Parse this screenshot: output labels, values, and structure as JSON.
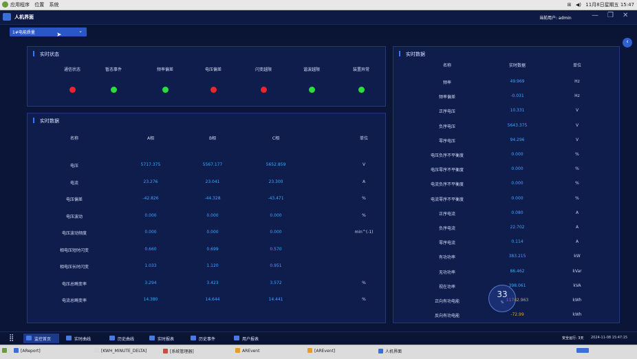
{
  "os_bar": {
    "menus": [
      "应用程序",
      "位置",
      "系统"
    ],
    "datetime": "11月8日星期五 15:47"
  },
  "window": {
    "title": "人机界面",
    "current_user": "当前用户: admin",
    "controls": {
      "minimize": "—",
      "maximize": "❐",
      "close": "✕"
    }
  },
  "device_select": {
    "value": "1#电能质量",
    "collapse": "‹"
  },
  "status_panel": {
    "title": "实时状态",
    "items": [
      {
        "label": "通信状态",
        "color": "#e8262b"
      },
      {
        "label": "暂态事件",
        "color": "#2bdc3a"
      },
      {
        "label": "频率偏差",
        "color": "#2bdc3a"
      },
      {
        "label": "电压偏差",
        "color": "#e8262b"
      },
      {
        "label": "闪变越限",
        "color": "#e8262b"
      },
      {
        "label": "谐波越限",
        "color": "#2bdc3a"
      },
      {
        "label": "装置异常",
        "color": "#2bdc3a"
      }
    ]
  },
  "phase_panel": {
    "title": "实时数据",
    "headers": [
      "名称",
      "A相",
      "B相",
      "C相",
      "单位"
    ],
    "rows": [
      [
        "电压",
        "5717.375",
        "5567.177",
        "5652.859",
        "V"
      ],
      [
        "电流",
        "23.276",
        "23.041",
        "23.300",
        "A"
      ],
      [
        "电压偏差",
        "-42.826",
        "-44.328",
        "-43.471",
        "%"
      ],
      [
        "电压波动",
        "0.000",
        "0.000",
        "0.000",
        "%"
      ],
      [
        "电压波动频度",
        "0.000",
        "0.000",
        "0.000",
        "min^(-1)"
      ],
      [
        "相电压短时闪变",
        "0.660",
        "0.699",
        "0.570",
        ""
      ],
      [
        "相电压长时闪变",
        "1.033",
        "1.120",
        "0.951",
        ""
      ],
      [
        "电压总畸变率",
        "3.294",
        "3.423",
        "3.572",
        "%"
      ],
      [
        "电流总畸变率",
        "14.380",
        "14.644",
        "14.441",
        "%"
      ]
    ]
  },
  "right_panel": {
    "title": "实时数据",
    "headers": [
      "名称",
      "实时数据",
      "单位"
    ],
    "rows": [
      [
        "频率",
        "49.969",
        "Hz"
      ],
      [
        "频率偏差",
        "-0.031",
        "Hz"
      ],
      [
        "正序电压",
        "10.331",
        "V"
      ],
      [
        "负序电压",
        "5643.375",
        "V"
      ],
      [
        "零序电压",
        "94.296",
        "V"
      ],
      [
        "电压负序不平衡度",
        "0.000",
        "%"
      ],
      [
        "电压零序不平衡度",
        "0.000",
        "%"
      ],
      [
        "电流负序不平衡度",
        "0.000",
        "%"
      ],
      [
        "电流零序不平衡度",
        "0.000",
        "%"
      ],
      [
        "正序电流",
        "0.080",
        "A"
      ],
      [
        "负序电流",
        "22.702",
        "A"
      ],
      [
        "零序电流",
        "0.114",
        "A"
      ],
      [
        "有功功率",
        "383.215",
        "kW"
      ],
      [
        "无功功率",
        "86.462",
        "kVar"
      ],
      [
        "视在功率",
        "398.061",
        "kVA"
      ],
      [
        "正向有功电能",
        "11782.963",
        "kWh"
      ],
      [
        "反向有功电能",
        "-72.99",
        "kWh"
      ]
    ],
    "overlay_badge": {
      "value": "33",
      "sub": "%"
    }
  },
  "nav": {
    "items": [
      "监控首页",
      "实时曲线",
      "历史曲线",
      "实时报表",
      "历史事件",
      "用户报表"
    ],
    "active_index": 0,
    "status": "安全运行: 3天",
    "datetime": "2024-11-08 15:47:15"
  },
  "taskbar": {
    "items": [
      "[AReport]",
      "[KWH_MINUTE_DELTA]",
      "[系统管理器]",
      "AREvent",
      "[AREvent]",
      "人机界面"
    ]
  }
}
